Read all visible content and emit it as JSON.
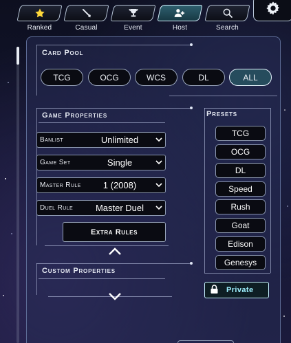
{
  "nav": {
    "tabs": [
      {
        "label": "Ranked",
        "icon": "star-icon"
      },
      {
        "label": "Casual",
        "icon": "sword-icon"
      },
      {
        "label": "Event",
        "icon": "trophy-icon"
      },
      {
        "label": "Host",
        "icon": "host-add-user-icon",
        "active": true
      },
      {
        "label": "Search",
        "icon": "search-icon"
      }
    ],
    "settings_icon": "gear-icon"
  },
  "card_pool": {
    "title": "Card Pool",
    "options": [
      "TCG",
      "OCG",
      "WCS",
      "DL",
      "ALL"
    ],
    "selected": "ALL"
  },
  "game_properties": {
    "title": "Game Properties",
    "rows": [
      {
        "label": "Banlist",
        "value": "Unlimited"
      },
      {
        "label": "Game Set",
        "value": "Single"
      },
      {
        "label": "Master Rule",
        "value": "1 (2008)"
      },
      {
        "label": "Duel Rule",
        "value": "Master Duel"
      }
    ],
    "extra_rules_label": "Extra Rules"
  },
  "presets": {
    "title": "Presets",
    "items": [
      "TCG",
      "OCG",
      "DL",
      "Speed",
      "Rush",
      "Goat",
      "Edison",
      "Genesys"
    ]
  },
  "custom_properties": {
    "title": "Custom Properties"
  },
  "private_button": {
    "label": "Private",
    "icon": "lock-icon"
  },
  "colors": {
    "accent": "#9ef0ff",
    "active_tab": "#2e5f6e",
    "panel_border": "#5d6c96"
  }
}
